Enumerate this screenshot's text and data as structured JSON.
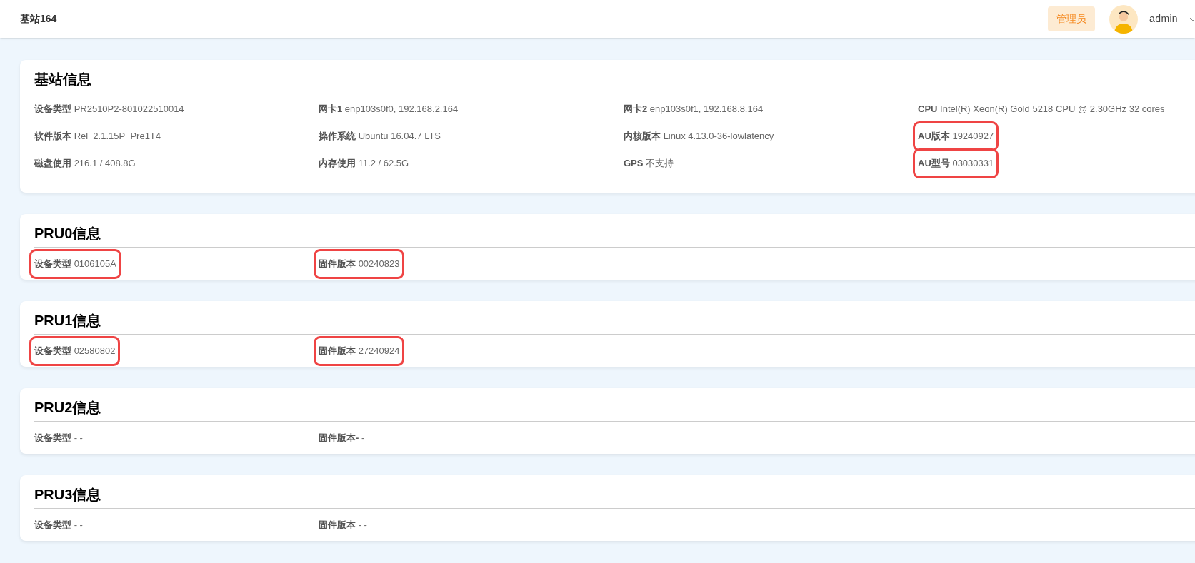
{
  "header": {
    "title": "基站164",
    "role_badge": "管理员",
    "username": "admin"
  },
  "sections": [
    {
      "title": "基站信息",
      "kind": "station",
      "fields": [
        {
          "label": "设备类型",
          "value": "PR2510P2-801022510014",
          "highlighted": false
        },
        {
          "label": "网卡1",
          "value": "enp103s0f0, 192.168.2.164",
          "highlighted": false
        },
        {
          "label": "网卡2",
          "value": "enp103s0f1, 192.168.8.164",
          "highlighted": false
        },
        {
          "label": "CPU",
          "value": "Intel(R) Xeon(R) Gold 5218 CPU @ 2.30GHz 32 cores",
          "highlighted": false
        },
        {
          "label": "软件版本",
          "value": "Rel_2.1.15P_Pre1T4",
          "highlighted": false
        },
        {
          "label": "操作系统",
          "value": "Ubuntu 16.04.7 LTS",
          "highlighted": false
        },
        {
          "label": "内核版本",
          "value": "Linux 4.13.0-36-lowlatency",
          "highlighted": false
        },
        {
          "label": "AU版本",
          "value": "19240927",
          "highlighted": true
        },
        {
          "label": "磁盘使用",
          "value": "216.1 / 408.8G",
          "highlighted": false
        },
        {
          "label": "内存使用",
          "value": "11.2 / 62.5G",
          "highlighted": false
        },
        {
          "label": "GPS",
          "value": "不支持",
          "highlighted": false
        },
        {
          "label": "AU型号",
          "value": "03030331",
          "highlighted": true
        }
      ]
    },
    {
      "title": "PRU0信息",
      "kind": "pru",
      "fields": [
        {
          "label": "设备类型",
          "value": "0106105A",
          "highlighted": true
        },
        {
          "label": "固件版本",
          "value": "00240823",
          "highlighted": true
        }
      ]
    },
    {
      "title": "PRU1信息",
      "kind": "pru",
      "fields": [
        {
          "label": "设备类型",
          "value": "02580802",
          "highlighted": true
        },
        {
          "label": "固件版本",
          "value": "27240924",
          "highlighted": true
        }
      ]
    },
    {
      "title": "PRU2信息",
      "kind": "pru",
      "fields": [
        {
          "label": "设备类型",
          "value": "- -",
          "highlighted": false
        },
        {
          "label": "固件版本-",
          "value": "-",
          "highlighted": false
        }
      ]
    },
    {
      "title": "PRU3信息",
      "kind": "pru",
      "fields": [
        {
          "label": "设备类型",
          "value": "- -",
          "highlighted": false
        },
        {
          "label": "固件版本",
          "value": "- -",
          "highlighted": false
        }
      ]
    }
  ]
}
